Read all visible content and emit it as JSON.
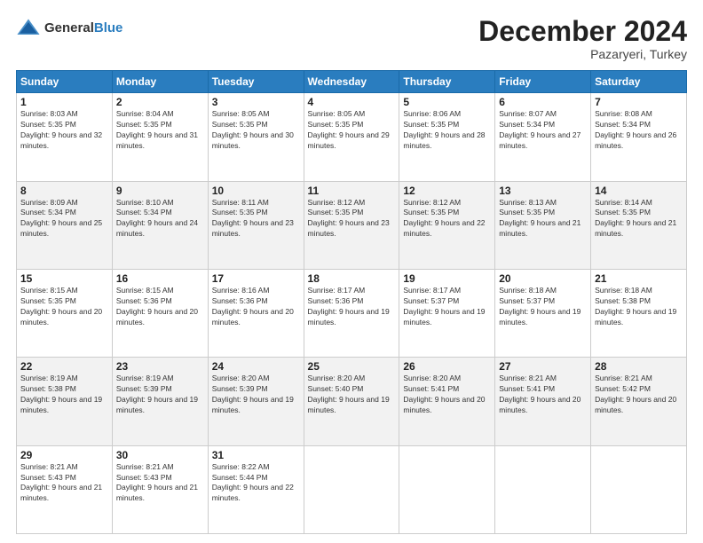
{
  "header": {
    "logo_general": "General",
    "logo_blue": "Blue",
    "month_title": "December 2024",
    "location": "Pazaryeri, Turkey"
  },
  "weekdays": [
    "Sunday",
    "Monday",
    "Tuesday",
    "Wednesday",
    "Thursday",
    "Friday",
    "Saturday"
  ],
  "weeks": [
    [
      {
        "day": "1",
        "sunrise": "Sunrise: 8:03 AM",
        "sunset": "Sunset: 5:35 PM",
        "daylight": "Daylight: 9 hours and 32 minutes."
      },
      {
        "day": "2",
        "sunrise": "Sunrise: 8:04 AM",
        "sunset": "Sunset: 5:35 PM",
        "daylight": "Daylight: 9 hours and 31 minutes."
      },
      {
        "day": "3",
        "sunrise": "Sunrise: 8:05 AM",
        "sunset": "Sunset: 5:35 PM",
        "daylight": "Daylight: 9 hours and 30 minutes."
      },
      {
        "day": "4",
        "sunrise": "Sunrise: 8:05 AM",
        "sunset": "Sunset: 5:35 PM",
        "daylight": "Daylight: 9 hours and 29 minutes."
      },
      {
        "day": "5",
        "sunrise": "Sunrise: 8:06 AM",
        "sunset": "Sunset: 5:35 PM",
        "daylight": "Daylight: 9 hours and 28 minutes."
      },
      {
        "day": "6",
        "sunrise": "Sunrise: 8:07 AM",
        "sunset": "Sunset: 5:34 PM",
        "daylight": "Daylight: 9 hours and 27 minutes."
      },
      {
        "day": "7",
        "sunrise": "Sunrise: 8:08 AM",
        "sunset": "Sunset: 5:34 PM",
        "daylight": "Daylight: 9 hours and 26 minutes."
      }
    ],
    [
      {
        "day": "8",
        "sunrise": "Sunrise: 8:09 AM",
        "sunset": "Sunset: 5:34 PM",
        "daylight": "Daylight: 9 hours and 25 minutes."
      },
      {
        "day": "9",
        "sunrise": "Sunrise: 8:10 AM",
        "sunset": "Sunset: 5:34 PM",
        "daylight": "Daylight: 9 hours and 24 minutes."
      },
      {
        "day": "10",
        "sunrise": "Sunrise: 8:11 AM",
        "sunset": "Sunset: 5:35 PM",
        "daylight": "Daylight: 9 hours and 23 minutes."
      },
      {
        "day": "11",
        "sunrise": "Sunrise: 8:12 AM",
        "sunset": "Sunset: 5:35 PM",
        "daylight": "Daylight: 9 hours and 23 minutes."
      },
      {
        "day": "12",
        "sunrise": "Sunrise: 8:12 AM",
        "sunset": "Sunset: 5:35 PM",
        "daylight": "Daylight: 9 hours and 22 minutes."
      },
      {
        "day": "13",
        "sunrise": "Sunrise: 8:13 AM",
        "sunset": "Sunset: 5:35 PM",
        "daylight": "Daylight: 9 hours and 21 minutes."
      },
      {
        "day": "14",
        "sunrise": "Sunrise: 8:14 AM",
        "sunset": "Sunset: 5:35 PM",
        "daylight": "Daylight: 9 hours and 21 minutes."
      }
    ],
    [
      {
        "day": "15",
        "sunrise": "Sunrise: 8:15 AM",
        "sunset": "Sunset: 5:35 PM",
        "daylight": "Daylight: 9 hours and 20 minutes."
      },
      {
        "day": "16",
        "sunrise": "Sunrise: 8:15 AM",
        "sunset": "Sunset: 5:36 PM",
        "daylight": "Daylight: 9 hours and 20 minutes."
      },
      {
        "day": "17",
        "sunrise": "Sunrise: 8:16 AM",
        "sunset": "Sunset: 5:36 PM",
        "daylight": "Daylight: 9 hours and 20 minutes."
      },
      {
        "day": "18",
        "sunrise": "Sunrise: 8:17 AM",
        "sunset": "Sunset: 5:36 PM",
        "daylight": "Daylight: 9 hours and 19 minutes."
      },
      {
        "day": "19",
        "sunrise": "Sunrise: 8:17 AM",
        "sunset": "Sunset: 5:37 PM",
        "daylight": "Daylight: 9 hours and 19 minutes."
      },
      {
        "day": "20",
        "sunrise": "Sunrise: 8:18 AM",
        "sunset": "Sunset: 5:37 PM",
        "daylight": "Daylight: 9 hours and 19 minutes."
      },
      {
        "day": "21",
        "sunrise": "Sunrise: 8:18 AM",
        "sunset": "Sunset: 5:38 PM",
        "daylight": "Daylight: 9 hours and 19 minutes."
      }
    ],
    [
      {
        "day": "22",
        "sunrise": "Sunrise: 8:19 AM",
        "sunset": "Sunset: 5:38 PM",
        "daylight": "Daylight: 9 hours and 19 minutes."
      },
      {
        "day": "23",
        "sunrise": "Sunrise: 8:19 AM",
        "sunset": "Sunset: 5:39 PM",
        "daylight": "Daylight: 9 hours and 19 minutes."
      },
      {
        "day": "24",
        "sunrise": "Sunrise: 8:20 AM",
        "sunset": "Sunset: 5:39 PM",
        "daylight": "Daylight: 9 hours and 19 minutes."
      },
      {
        "day": "25",
        "sunrise": "Sunrise: 8:20 AM",
        "sunset": "Sunset: 5:40 PM",
        "daylight": "Daylight: 9 hours and 19 minutes."
      },
      {
        "day": "26",
        "sunrise": "Sunrise: 8:20 AM",
        "sunset": "Sunset: 5:41 PM",
        "daylight": "Daylight: 9 hours and 20 minutes."
      },
      {
        "day": "27",
        "sunrise": "Sunrise: 8:21 AM",
        "sunset": "Sunset: 5:41 PM",
        "daylight": "Daylight: 9 hours and 20 minutes."
      },
      {
        "day": "28",
        "sunrise": "Sunrise: 8:21 AM",
        "sunset": "Sunset: 5:42 PM",
        "daylight": "Daylight: 9 hours and 20 minutes."
      }
    ],
    [
      {
        "day": "29",
        "sunrise": "Sunrise: 8:21 AM",
        "sunset": "Sunset: 5:43 PM",
        "daylight": "Daylight: 9 hours and 21 minutes."
      },
      {
        "day": "30",
        "sunrise": "Sunrise: 8:21 AM",
        "sunset": "Sunset: 5:43 PM",
        "daylight": "Daylight: 9 hours and 21 minutes."
      },
      {
        "day": "31",
        "sunrise": "Sunrise: 8:22 AM",
        "sunset": "Sunset: 5:44 PM",
        "daylight": "Daylight: 9 hours and 22 minutes."
      },
      null,
      null,
      null,
      null
    ]
  ]
}
